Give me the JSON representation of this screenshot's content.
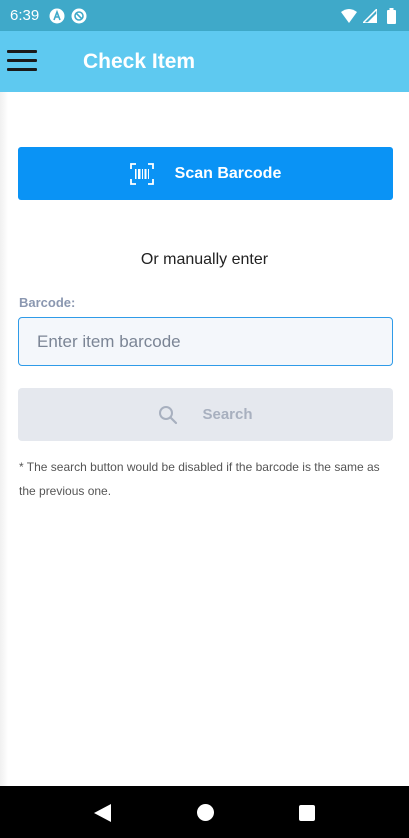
{
  "status_bar": {
    "time": "6:39",
    "left_icons": [
      "a-circle-icon",
      "no-entry-circle-icon"
    ],
    "right_icons": [
      "wifi-icon",
      "signal-icon",
      "battery-icon"
    ]
  },
  "app_bar": {
    "title": "Check Item",
    "menu_icon": "hamburger-menu-icon",
    "color": "#5ec9f0"
  },
  "scan": {
    "label": "Scan Barcode",
    "icon": "barcode-scan-icon",
    "color": "#0a93f5"
  },
  "manual": {
    "text": "Or manually enter"
  },
  "barcode": {
    "label": "Barcode:",
    "placeholder": "Enter item barcode",
    "value": ""
  },
  "search": {
    "label": "Search",
    "icon": "search-icon",
    "disabled": true
  },
  "note": "* The search button would be disabled if the barcode is the same as the previous one.",
  "nav_bar": {
    "icons": [
      "back-icon",
      "home-icon",
      "recents-icon"
    ]
  }
}
